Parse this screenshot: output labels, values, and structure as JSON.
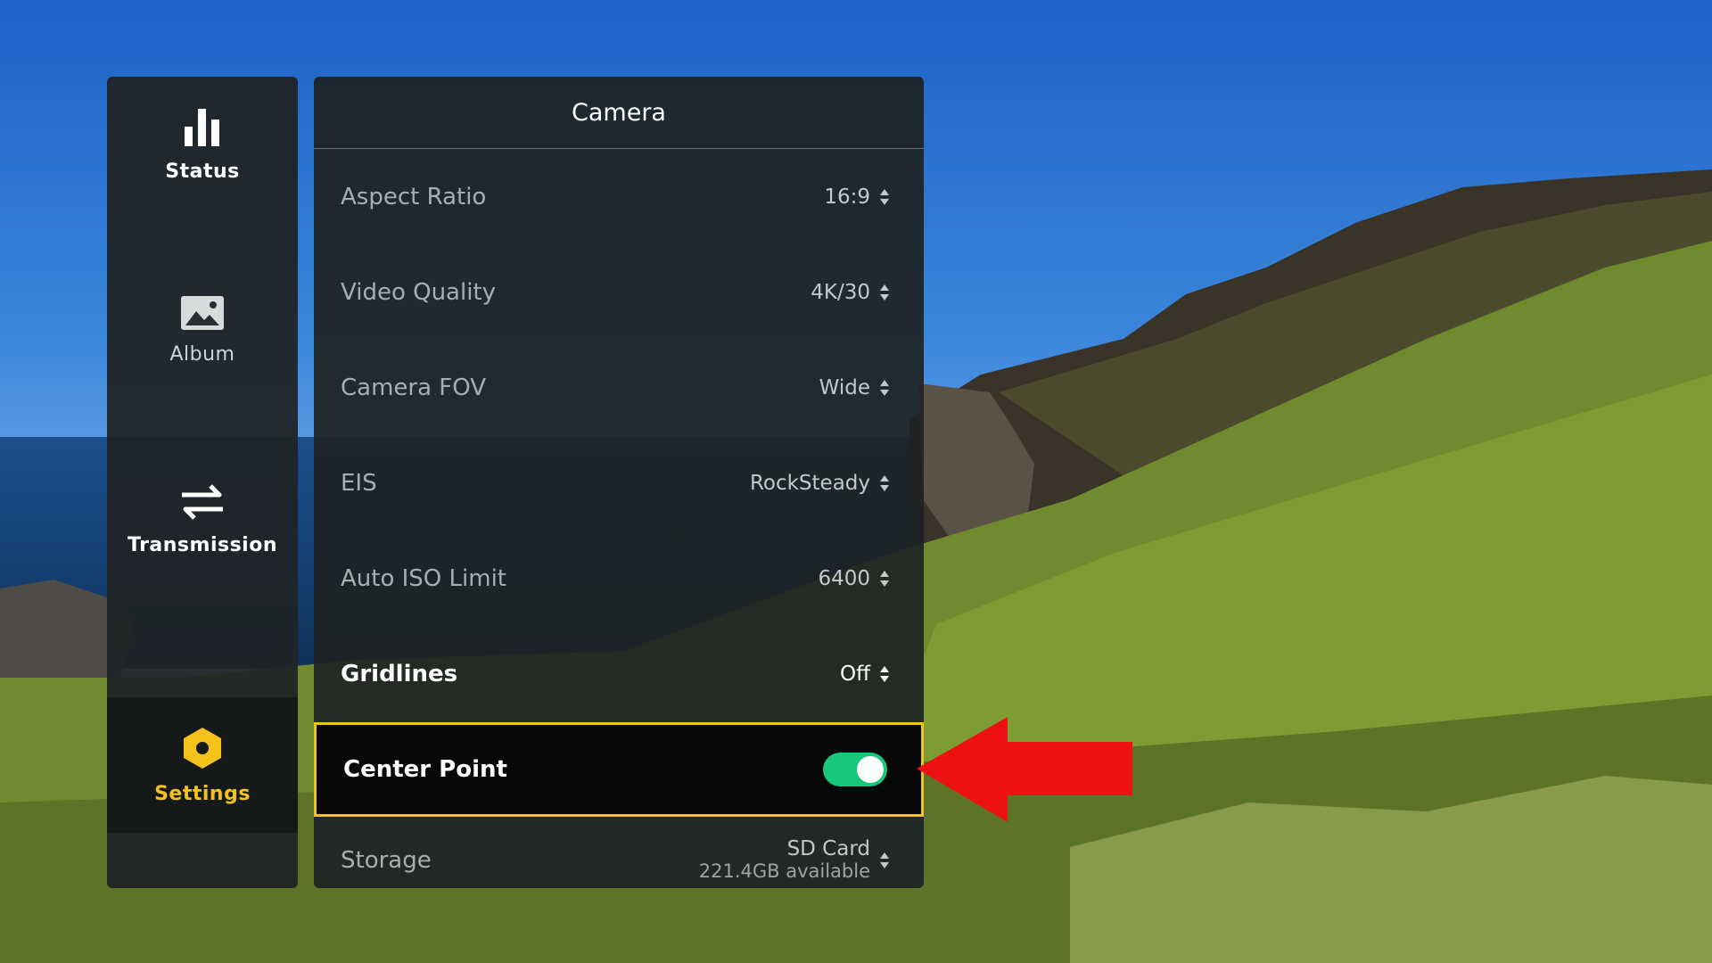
{
  "nav": {
    "items": [
      {
        "label": "Status",
        "icon": "bar-chart-icon"
      },
      {
        "label": "Album",
        "icon": "image-icon"
      },
      {
        "label": "Transmission",
        "icon": "swap-arrows-icon"
      },
      {
        "label": "Settings",
        "icon": "hexagon-gear-icon",
        "active": true
      }
    ]
  },
  "panel": {
    "title": "Camera",
    "rows": [
      {
        "label": "Aspect Ratio",
        "value": "16:9"
      },
      {
        "label": "Video Quality",
        "value": "4K/30"
      },
      {
        "label": "Camera FOV",
        "value": "Wide"
      },
      {
        "label": "EIS",
        "value": "RockSteady"
      },
      {
        "label": "Auto ISO Limit",
        "value": "6400"
      },
      {
        "label": "Gridlines",
        "value": "Off"
      }
    ],
    "center_point": {
      "label": "Center Point",
      "enabled": true
    },
    "storage": {
      "label": "Storage",
      "value": "SD Card",
      "available": "221.4GB available"
    }
  },
  "colors": {
    "accent": "#f4c21b",
    "toggle_on": "#19c77a",
    "callout_arrow": "#ee1111"
  }
}
